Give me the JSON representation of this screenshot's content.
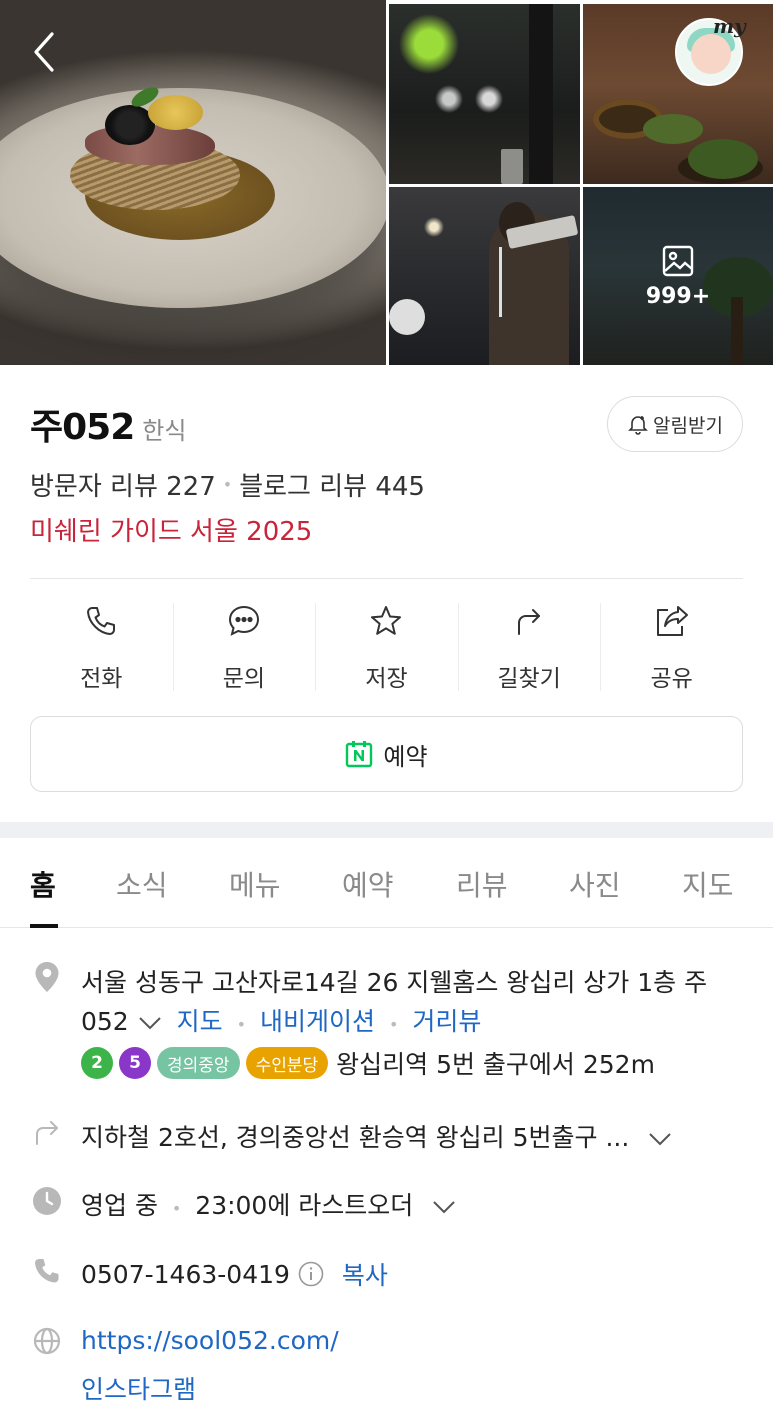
{
  "header": {
    "back_icon": "chevron-left-icon",
    "my_label": "my",
    "photo_count": "999+"
  },
  "place": {
    "name": "주052",
    "category": "한식",
    "notify_label": "알림받기",
    "visitor_reviews": "방문자 리뷰 227",
    "blog_reviews": "블로그 리뷰 445",
    "michelin": "미쉐린 가이드 서울 2025"
  },
  "actions": [
    {
      "label": "전화",
      "icon": "phone-icon"
    },
    {
      "label": "문의",
      "icon": "chat-icon"
    },
    {
      "label": "저장",
      "icon": "star-icon"
    },
    {
      "label": "길찾기",
      "icon": "directions-icon"
    },
    {
      "label": "공유",
      "icon": "share-icon"
    }
  ],
  "reserve_label": "예약",
  "tabs": [
    "홈",
    "소식",
    "메뉴",
    "예약",
    "리뷰",
    "사진",
    "지도"
  ],
  "info": {
    "address_line1": "서울 성동구 고산자로14길 26 지웰홈스 왕십리 상가 1층 주",
    "address_line2": "052",
    "map_link": "지도",
    "nav_link": "내비게이션",
    "street_link": "거리뷰",
    "subway_lines": [
      {
        "label": "2",
        "color": "#3cb44a",
        "round": true
      },
      {
        "label": "5",
        "color": "#8a36c9",
        "round": true
      },
      {
        "label": "경의중앙",
        "color": "#77c4a3",
        "round": false
      },
      {
        "label": "수인분당",
        "color": "#e9a300",
        "round": false
      }
    ],
    "station_text": "왕십리역 5번 출구에서 252m",
    "directions_text": "지하철 2호선, 경의중앙선 환승역 왕십리 5번출구 ...",
    "hours_status": "영업 중",
    "hours_detail": "23:00에 라스트오더",
    "phone": "0507-1463-0419",
    "copy_label": "복사",
    "website": "https://sool052.com/",
    "instagram": "인스타그램"
  },
  "colors": {
    "michelin_red": "#c8243a",
    "link_blue": "#1f67c4",
    "naver_green": "#03c75a"
  }
}
